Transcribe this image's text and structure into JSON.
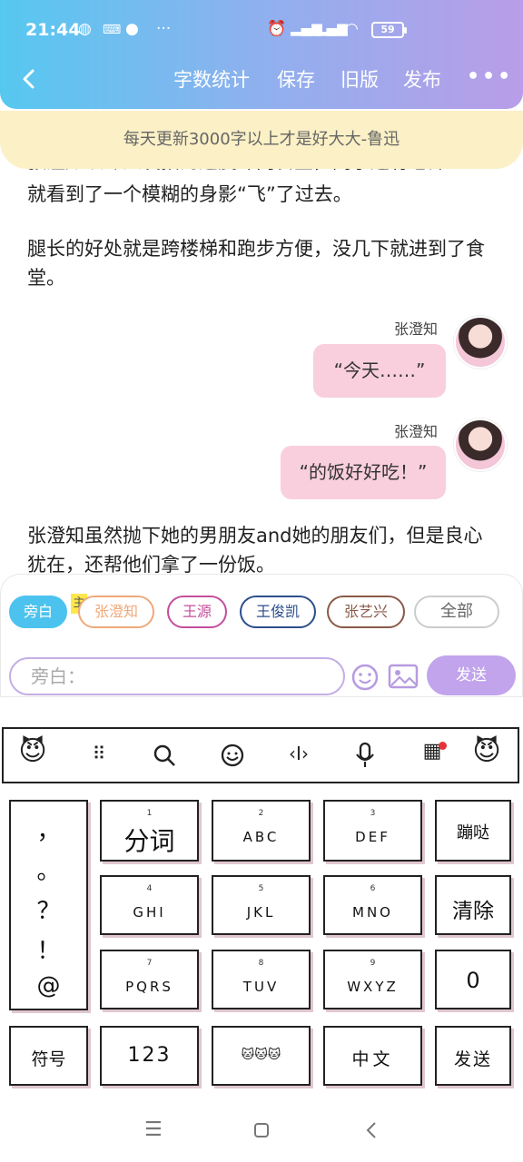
{
  "status_bar": {
    "time": "21:44",
    "battery": "59"
  },
  "header": {
    "nav_items": [
      "字数统计",
      "保存",
      "旧版",
      "发布"
    ],
    "more": "•••"
  },
  "notice": "每天更新3000字以上才是好大大-鲁迅",
  "content": {
    "cut_line": "张澄知以令人发指的速度冲向食堂，同学还有老师",
    "para1": "就看到了一个模糊的身影“飞”了过去。",
    "para2": "腿长的好处就是跨楼梯和跑步方便，没几下就进到了食堂。",
    "messages": [
      {
        "name": "张澄知",
        "text": "“今天……”"
      },
      {
        "name": "张澄知",
        "text": "“的饭好好吃！”"
      }
    ],
    "para3": "张澄知虽然抛下她的男朋友and她的朋友们，但是良心犹在，还帮他们拿了一份饭。"
  },
  "roles": [
    {
      "label": "旁白",
      "color": "#4cc3ee"
    },
    {
      "label": "张澄知",
      "color": "#f0a97a"
    },
    {
      "label": "王源",
      "color": "#c44e9b"
    },
    {
      "label": "王俊凯",
      "color": "#2c4e8c"
    },
    {
      "label": "张艺兴",
      "color": "#8a5a48"
    },
    {
      "label": "全部",
      "color": "#bbbbbb"
    }
  ],
  "main_tag": "主",
  "input": {
    "placeholder": "旁白："
  },
  "send_label": "发送",
  "keyboard": {
    "left_symbols": [
      "，",
      "。",
      "？",
      "！",
      "@"
    ],
    "keys": [
      {
        "num": "1",
        "main": "分词"
      },
      {
        "num": "2",
        "main": "ABC"
      },
      {
        "num": "3",
        "main": "DEF"
      },
      {
        "num": "",
        "main": "蹦哒"
      },
      {
        "num": "4",
        "main": "GHI"
      },
      {
        "num": "5",
        "main": "JKL"
      },
      {
        "num": "6",
        "main": "MNO"
      },
      {
        "num": "",
        "main": "清除"
      },
      {
        "num": "7",
        "main": "PQRS"
      },
      {
        "num": "8",
        "main": "TUV"
      },
      {
        "num": "9",
        "main": "WXYZ"
      },
      {
        "num": "",
        "main": "0"
      }
    ],
    "bottom": [
      "符号",
      "123",
      "🐱🐱🐱",
      "中文",
      "发送"
    ]
  }
}
